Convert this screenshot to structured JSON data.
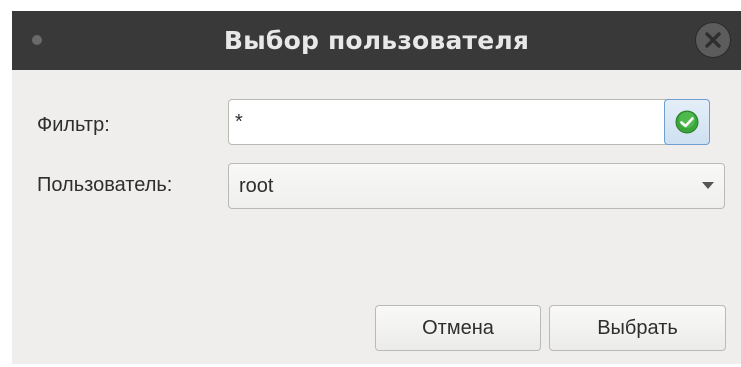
{
  "window": {
    "title": "Выбор пользователя"
  },
  "filter": {
    "label": "Фильтр:",
    "value": "*",
    "apply_icon": "check-circle-icon"
  },
  "user": {
    "label": "Пользователь:",
    "selected": "root"
  },
  "buttons": {
    "cancel": "Отмена",
    "choose": "Выбрать"
  },
  "colors": {
    "titlebar": "#393939",
    "dialog_background": "#efeeec",
    "apply_accent": "#3aa53a"
  }
}
